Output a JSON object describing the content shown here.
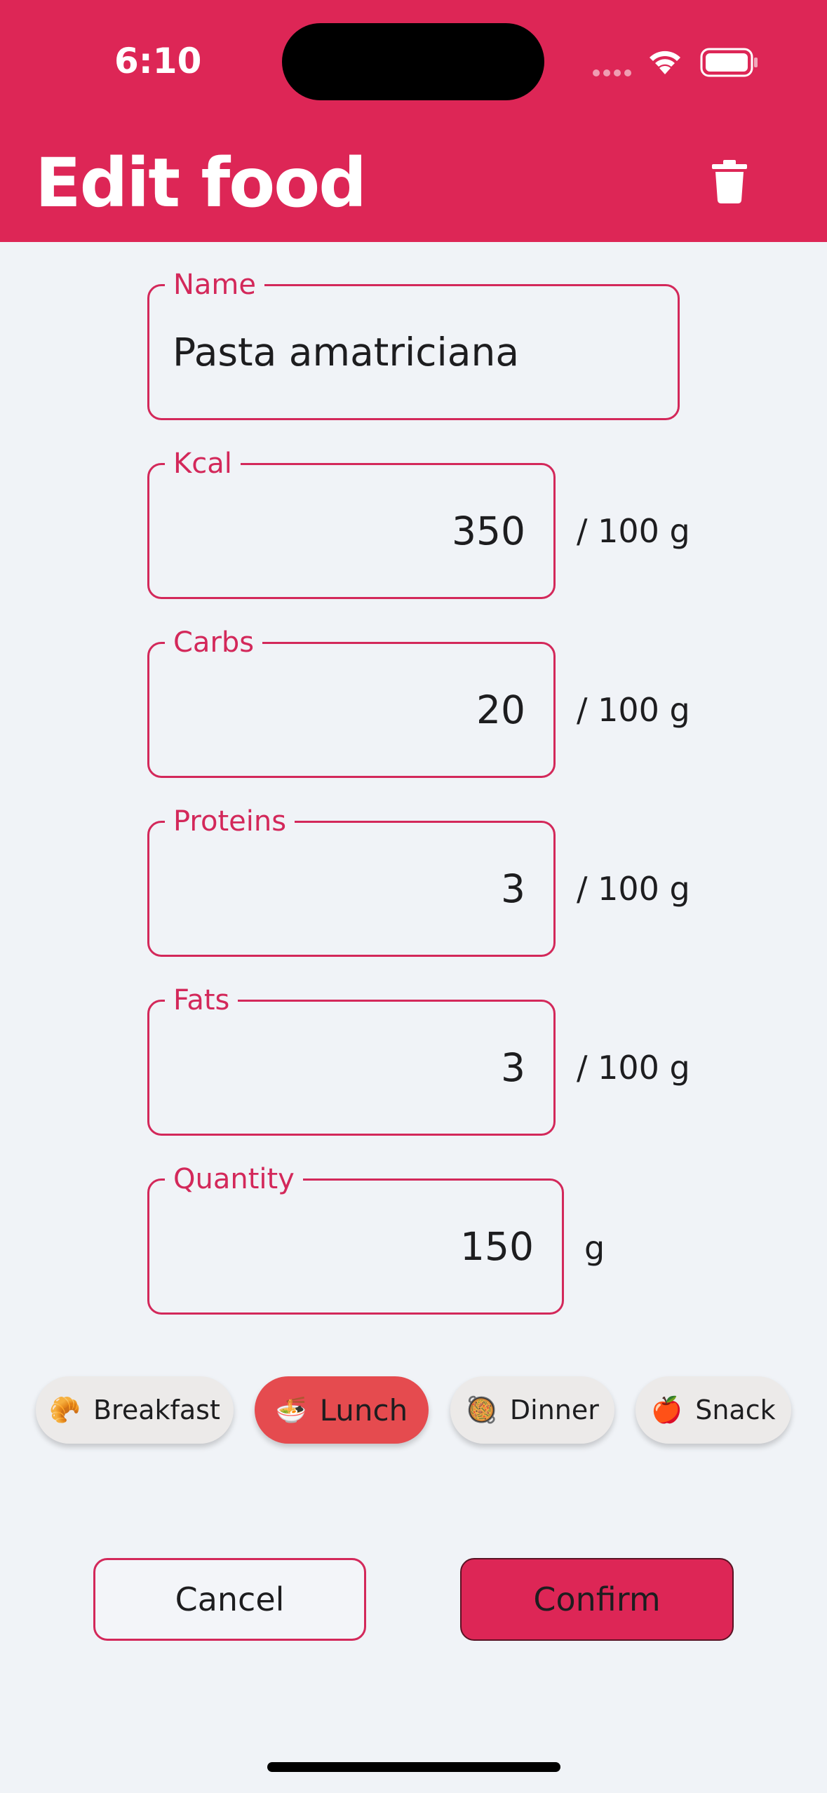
{
  "status": {
    "time": "6:10"
  },
  "header": {
    "title": "Edit food"
  },
  "form": {
    "name": {
      "label": "Name",
      "value": "Pasta amatriciana"
    },
    "kcal": {
      "label": "Kcal",
      "value": "350",
      "unit": "/ 100 g"
    },
    "carbs": {
      "label": "Carbs",
      "value": "20",
      "unit": "/ 100 g"
    },
    "proteins": {
      "label": "Proteins",
      "value": "3",
      "unit": "/ 100 g"
    },
    "fats": {
      "label": "Fats",
      "value": "3",
      "unit": "/ 100 g"
    },
    "quantity": {
      "label": "Quantity",
      "value": "150",
      "unit": "g"
    }
  },
  "meals": [
    {
      "emoji": "🥐",
      "label": "Breakfast",
      "selected": false
    },
    {
      "emoji": "🍜",
      "label": "Lunch",
      "selected": true
    },
    {
      "emoji": "🥘",
      "label": "Dinner",
      "selected": false
    },
    {
      "emoji": "🍎",
      "label": "Snack",
      "selected": false
    }
  ],
  "actions": {
    "cancel": "Cancel",
    "confirm": "Confirm"
  },
  "colors": {
    "primary": "#dd2656",
    "selected_chip": "#e54b4f",
    "background": "#f0f3f7"
  }
}
